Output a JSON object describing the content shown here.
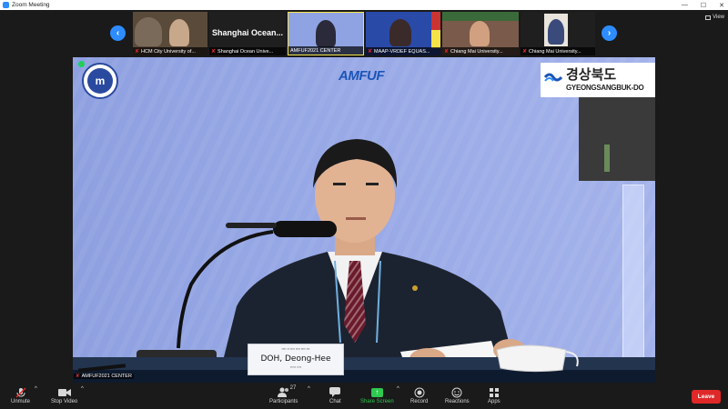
{
  "window": {
    "title": "Zoom Meeting",
    "controls": [
      "—",
      "☐",
      "✕"
    ],
    "view_label": "View"
  },
  "gallery": {
    "tiles": [
      {
        "caption": "HCM City University of...",
        "muted": true
      },
      {
        "caption": "Shanghai Ocean Unive...",
        "muted": true,
        "big_name": "Shanghai Ocean..."
      },
      {
        "caption": "AMFUF2021 CENTER",
        "muted": false
      },
      {
        "caption": "MAAP-VRDEF EQUAS...",
        "muted": true
      },
      {
        "caption": "Chiang Mai University...",
        "muted": true
      },
      {
        "caption": "Chiang Mai University...",
        "muted": true
      }
    ],
    "prev_arrow": "‹",
    "next_arrow": "›"
  },
  "main_video": {
    "center_logo": "AMFUF",
    "right_logo_korean": "경상북도",
    "right_logo_english": "GYEONGSANGBUK-DO",
    "left_logo_text": "m",
    "overlay_label": "AMFUF2021 CENTER",
    "nameplate": {
      "name": "DOH, Deong-Hee"
    }
  },
  "toolbar": {
    "unmute": "Unmute",
    "stop_video": "Stop Video",
    "participants": "Participants",
    "participants_count": "27",
    "chat": "Chat",
    "share_screen": "Share Screen",
    "record": "Record",
    "reactions": "Reactions",
    "apps": "Apps",
    "leave": "Leave"
  },
  "colors": {
    "accent": "#2d8cff",
    "leave": "#e02828",
    "share": "#2ec94f",
    "background": "#1a1a1a"
  }
}
